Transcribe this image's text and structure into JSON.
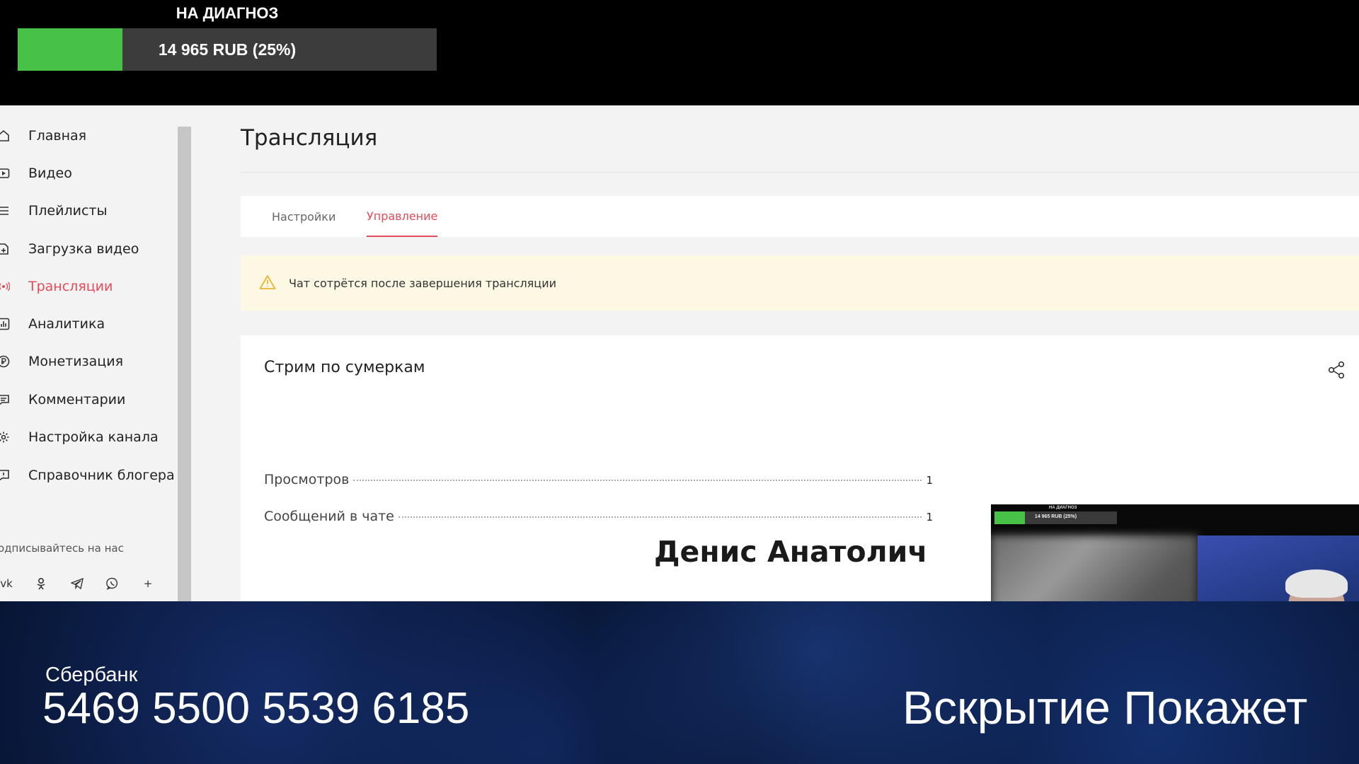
{
  "donation": {
    "title": "НА ДИАГНОЗ",
    "amount_text": "14 965 RUB (25%)",
    "progress": 0.25,
    "fill_color": "#47c247"
  },
  "studio": {
    "sidebar": {
      "items": [
        {
          "label": "Главная",
          "icon": "home-icon"
        },
        {
          "label": "Видео",
          "icon": "video-icon"
        },
        {
          "label": "Плейлисты",
          "icon": "playlist-icon"
        },
        {
          "label": "Загрузка видео",
          "icon": "upload-icon"
        },
        {
          "label": "Трансляции",
          "icon": "broadcast-icon",
          "active": true
        },
        {
          "label": "Аналитика",
          "icon": "analytics-icon"
        },
        {
          "label": "Монетизация",
          "icon": "ruble-icon"
        },
        {
          "label": "Комментарии",
          "icon": "comments-icon"
        },
        {
          "label": "Настройка канала",
          "icon": "gear-icon"
        },
        {
          "label": "Справочник блогера",
          "icon": "info-icon"
        }
      ],
      "follow_label": "одписывайтесь на нас",
      "socials": [
        "vk-icon",
        "odnoklassniki-icon",
        "telegram-icon",
        "viber-icon",
        "plus-icon"
      ]
    },
    "page_title": "Трансляция",
    "tabs": [
      {
        "label": "Настройки",
        "active": false
      },
      {
        "label": "Управление",
        "active": true
      }
    ],
    "notice": "Чат сотрётся после завершения трансляции",
    "stream": {
      "title": "Стрим по сумеркам",
      "stats": [
        {
          "label": "Просмотров",
          "value": "1"
        },
        {
          "label": "Сообщений в чате",
          "value": "1"
        }
      ],
      "chat_name_overlay": "Денис Анатолич Н"
    },
    "preview": {
      "mini_title": "НА ДИАГНОЗ",
      "mini_amount": "14 965 RUB (25%)",
      "playback_progress": 0.98
    },
    "accent_color": "#e44b5b"
  },
  "banner": {
    "bank": "Сбербанк",
    "card_number": "5469 5500 5539 6185",
    "slogan": "Вскрытие Покажет"
  }
}
